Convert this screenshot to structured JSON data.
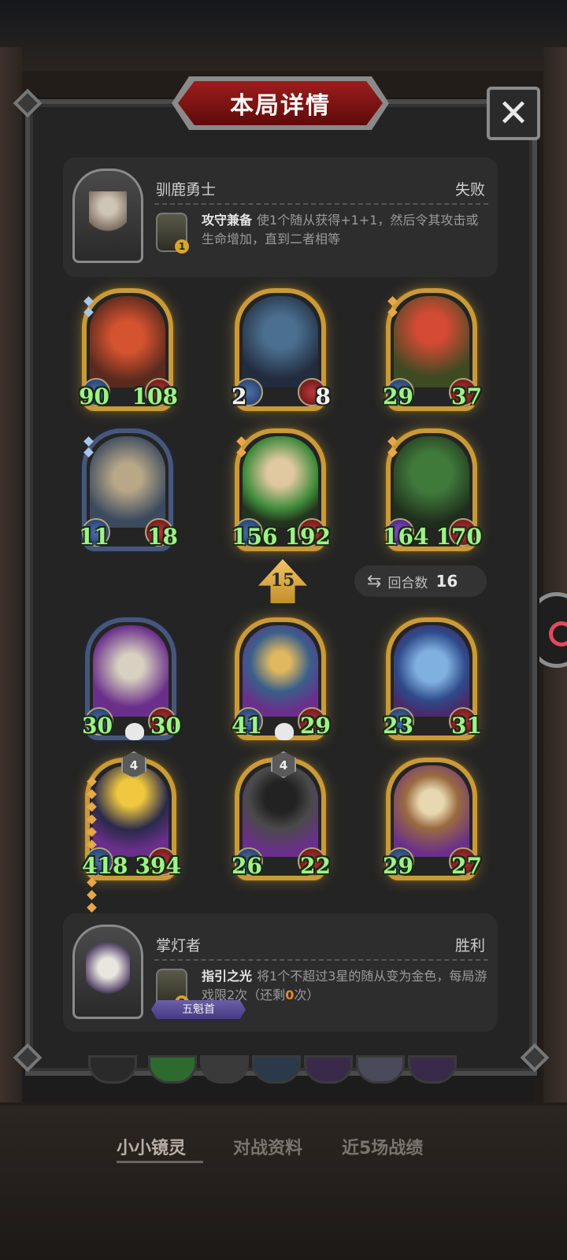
{
  "dialog": {
    "title": "本局详情",
    "close_label": "✕"
  },
  "top_player": {
    "name": "驯鹿勇士",
    "result": "失败",
    "skill_level": "1",
    "skill_name": "攻守兼备",
    "skill_text": "使1个随从获得+1+1，然后令其攻击或生命增加，直到二者相等"
  },
  "bottom_player": {
    "name": "掌灯者",
    "result": "胜利",
    "skill_level": "2",
    "skill_name": "指引之光",
    "skill_text_a": "将1个不超过3星的随从变为金色，每局游戏限2次（还剩",
    "skill_remaining": "0",
    "skill_text_b": "次）",
    "rank": "五魁首"
  },
  "turn_marker": {
    "value": "15",
    "round_label": "回合数",
    "round_value": "16"
  },
  "top_minions": [
    {
      "atk": "90",
      "hp": "108",
      "attack_shown": 90,
      "health_shown": 108
    },
    {
      "atk": "2",
      "hp": "8",
      "attack_shown": 2,
      "health_shown": 8
    },
    {
      "atk": "29",
      "hp": "37",
      "attack_shown": 29,
      "health_shown": 37
    },
    {
      "atk": "11",
      "hp": "18",
      "attack_shown": 11,
      "health_shown": 18
    },
    {
      "atk": "156",
      "hp": "192",
      "attack_shown": 156,
      "health_shown": 192
    },
    {
      "atk": "164",
      "hp": "170",
      "attack_shown": 164,
      "health_shown": 170
    }
  ],
  "bottom_minions": [
    {
      "atk": "30",
      "hp": "30"
    },
    {
      "atk": "41",
      "hp": "29"
    },
    {
      "atk": "23",
      "hp": "31"
    },
    {
      "atk": "418",
      "hp": "394",
      "level": "4"
    },
    {
      "atk": "26",
      "hp": "22",
      "level": "4"
    },
    {
      "atk": "29",
      "hp": "27"
    }
  ],
  "tabs": {
    "tab1": "小小镜灵",
    "tab2": "对战资料",
    "tab3": "近5场战绩"
  },
  "colors": {
    "stat_green": "#9ff28a",
    "gold_frame": "#c99a3a",
    "title_red": "#9c1d1d",
    "remaining_orange": "#e38a2b"
  }
}
